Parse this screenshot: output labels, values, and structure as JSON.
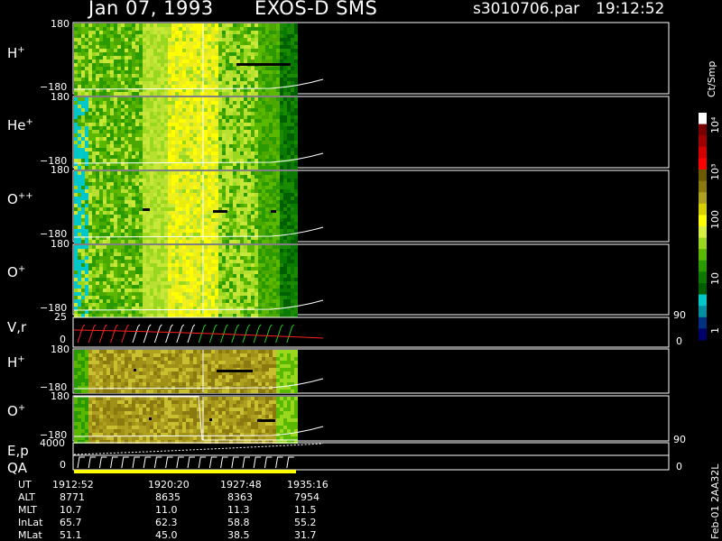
{
  "header": {
    "date": "Jan 07, 1993",
    "instrument": "EXOS-D SMS",
    "file": "s3010706.par",
    "time": "19:12:52"
  },
  "panels": [
    {
      "id": "h_plus",
      "label": "H",
      "sup": "+",
      "ytop": "180",
      "ybot": "−180"
    },
    {
      "id": "he_plus",
      "label": "He",
      "sup": "+",
      "ytop": "180",
      "ybot": "−180"
    },
    {
      "id": "o_plusplus",
      "label": "O",
      "sup": "++",
      "ytop": "180",
      "ybot": "−180"
    },
    {
      "id": "o_plus",
      "label": "O",
      "sup": "+",
      "ytop": "180",
      "ybot": "−180"
    },
    {
      "id": "vr",
      "label": "V,r",
      "sup": "",
      "ytop": "25",
      "ybot": "0",
      "rtop": "90",
      "rbot": "0"
    },
    {
      "id": "h_plus_2",
      "label": "H",
      "sup": "+",
      "ytop": "180",
      "ybot": "−180"
    },
    {
      "id": "o_plus_2",
      "label": "O",
      "sup": "+",
      "ytop": "180",
      "ybot": "−180"
    },
    {
      "id": "ep",
      "label": "E,p",
      "sup": "",
      "ytop": "4000",
      "rtop": "90"
    },
    {
      "id": "qa",
      "label": "QA",
      "sup": "",
      "ytop": "0",
      "rbot": "0"
    }
  ],
  "colorbar": {
    "unit": "Ct/Smp",
    "ticks": [
      "10⁴",
      "10³",
      "100",
      "10",
      "1"
    ],
    "colors": [
      "#ffffff",
      "#7a0000",
      "#a00000",
      "#d40000",
      "#ff0000",
      "#6b5a00",
      "#8a7a10",
      "#b0a020",
      "#d8d000",
      "#ffff00",
      "#d8f040",
      "#9ad820",
      "#5ab800",
      "#2a9a00",
      "#0a7a00",
      "#006000",
      "#00c8c8",
      "#0090a0",
      "#003080",
      "#00006a"
    ]
  },
  "footer": {
    "rows": [
      {
        "label": "UT",
        "values": [
          "1912:52",
          "1920:20",
          "1927:48",
          "1935:16"
        ]
      },
      {
        "label": "ALT",
        "values": [
          "8771",
          "8635",
          "8363",
          "7954"
        ]
      },
      {
        "label": "MLT",
        "values": [
          "10.7",
          "11.0",
          "11.3",
          "11.5"
        ]
      },
      {
        "label": "InLat",
        "values": [
          "65.7",
          "62.3",
          "58.8",
          "55.2"
        ]
      },
      {
        "label": "MLat",
        "values": [
          "51.1",
          "45.0",
          "38.5",
          "31.7"
        ]
      }
    ],
    "version": "Feb-01 2AA32L"
  }
}
